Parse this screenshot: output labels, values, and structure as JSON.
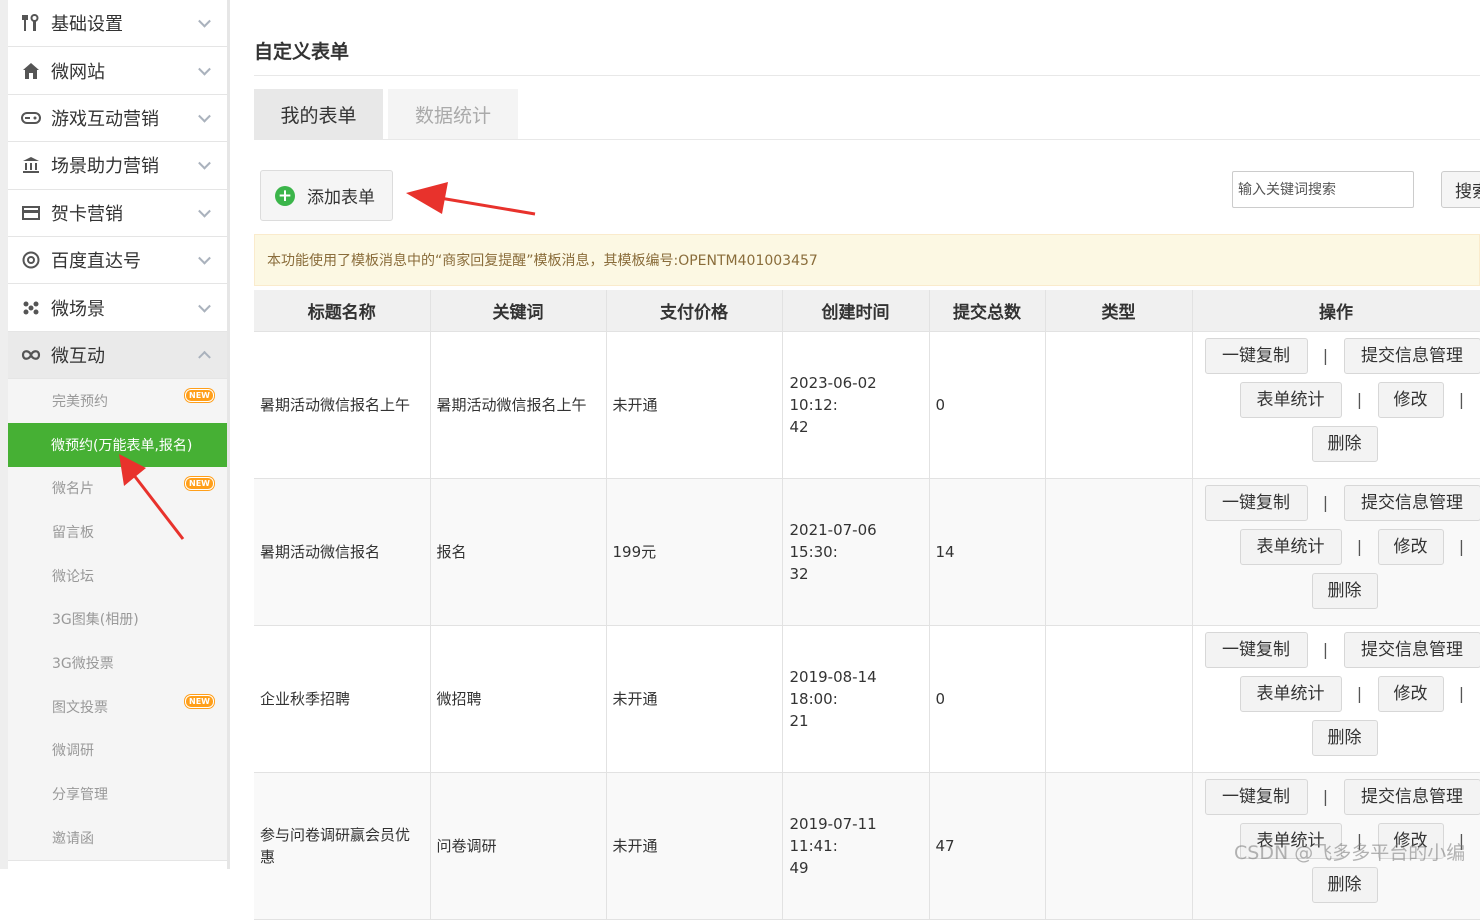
{
  "sidebar": {
    "menu": [
      {
        "label": "基础设置",
        "icon": "tools-icon"
      },
      {
        "label": "微网站",
        "icon": "home-icon"
      },
      {
        "label": "游戏互动营销",
        "icon": "gamepad-icon"
      },
      {
        "label": "场景助力营销",
        "icon": "bank-icon"
      },
      {
        "label": "贺卡营销",
        "icon": "card-icon"
      },
      {
        "label": "百度直达号",
        "icon": "at-icon"
      },
      {
        "label": "微场景",
        "icon": "dots-icon"
      },
      {
        "label": "微互动",
        "icon": "loop-icon"
      }
    ],
    "submenu": [
      {
        "label": "完美预约",
        "badge": "NEW"
      },
      {
        "label": "微预约(万能表单,报名)",
        "badge": ""
      },
      {
        "label": "微名片",
        "badge": "NEW"
      },
      {
        "label": "留言板",
        "badge": ""
      },
      {
        "label": "微论坛",
        "badge": ""
      },
      {
        "label": "3G图集(相册)",
        "badge": ""
      },
      {
        "label": "3G微投票",
        "badge": ""
      },
      {
        "label": "图文投票",
        "badge": "NEW"
      },
      {
        "label": "微调研",
        "badge": ""
      },
      {
        "label": "分享管理",
        "badge": ""
      },
      {
        "label": "邀请函",
        "badge": ""
      }
    ]
  },
  "page": {
    "title": "自定义表单",
    "tabs": [
      {
        "label": "我的表单"
      },
      {
        "label": "数据统计"
      }
    ],
    "add_label": "添加表单",
    "search_placeholder": "输入关键词搜索",
    "search_label": "搜索",
    "notice": "本功能使用了模板消息中的“商家回复提醒”模板消息，其模板编号:OPENTM401003457"
  },
  "table": {
    "headers": [
      "标题名称",
      "关键词",
      "支付价格",
      "创建时间",
      "提交总数",
      "类型",
      "操作"
    ],
    "rows": [
      {
        "title": "暑期活动微信报名上午",
        "keyword": "暑期活动微信报名上午",
        "price": "未开通",
        "time1": "2023-06-02 10:12:",
        "time2": "42",
        "count": "0",
        "type": ""
      },
      {
        "title": "暑期活动微信报名",
        "keyword": "报名",
        "price": "199元",
        "time1": "2021-07-06 15:30:",
        "time2": "32",
        "count": "14",
        "type": ""
      },
      {
        "title": "企业秋季招聘",
        "keyword": "微招聘",
        "price": "未开通",
        "time1": "2019-08-14 18:00:",
        "time2": "21",
        "count": "0",
        "type": ""
      },
      {
        "title": "参与问卷调研赢会员优惠",
        "keyword": "问卷调研",
        "price": "未开通",
        "time1": "2019-07-11 11:41:",
        "time2": "49",
        "count": "47",
        "type": ""
      }
    ],
    "actions": {
      "copy": "一键复制",
      "manage": "提交信息管理",
      "stats": "表单统计",
      "edit": "修改",
      "delete": "删除",
      "separator": "|"
    }
  },
  "watermark": "CSDN @飞多多平台的小编",
  "colors": {
    "active_green": "#46b034",
    "notice_bg": "#fcf8e3",
    "notice_text": "#8a6d3b",
    "arrow_red": "#e8322c",
    "badge_orange": "#ff9f1a"
  }
}
